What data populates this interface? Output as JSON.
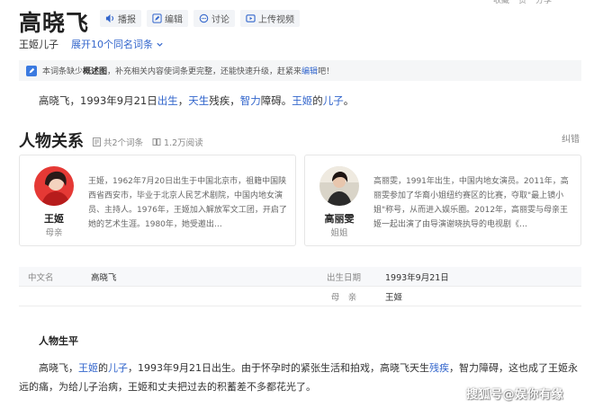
{
  "top_clip": [
    "收藏",
    "赞",
    "分享"
  ],
  "title": "高晓飞",
  "actions": [
    {
      "label": "播报",
      "icon": "speaker-icon"
    },
    {
      "label": "编辑",
      "icon": "pencil-icon"
    },
    {
      "label": "讨论",
      "icon": "chat-icon"
    },
    {
      "label": "上传视频",
      "icon": "video-icon"
    }
  ],
  "subtitle": {
    "son": "王姬儿子",
    "expand": "展开10个同名词条"
  },
  "notice": {
    "pre": "本词条缺少",
    "bold": "概述图",
    "mid": "，补充相关内容使词条更完整，还能快速升级，赶紧来",
    "link": "编辑",
    "post": "吧！"
  },
  "intro": {
    "p1": "高晓飞，1993年9月21日",
    "l1": "出生",
    "p2": "，",
    "l2": "天生",
    "p3": "残疾，",
    "l3": "智力",
    "p4": "障碍。",
    "l4": "王姬",
    "p5": "的",
    "l5": "儿子",
    "p6": "。"
  },
  "relations": {
    "title": "人物关系",
    "entries": "共2个词条",
    "views": "1.2万阅读",
    "error": "纠错",
    "cards": [
      {
        "name": "王姬",
        "relation": "母亲",
        "desc": "王姬，1962年7月20日出生于中国北京市，祖籍中国陕西省西安市，毕业于北京人民艺术剧院，中国内地女演员、主持人。1976年，王姬加入解放军文工团，开启了她的艺术生涯。1980年，她受邀出…"
      },
      {
        "name": "高丽雯",
        "relation": "姐姐",
        "desc": "高丽雯，1991年出生，中国内地女演员。2011年，高丽雯参加了华裔小姐纽约赛区的比赛，夺取\"最上镜小姐\"称号，从而进入娱乐圈。2012年，高丽雯与母亲王姬一起出演了由导演谢晓执导的电视剧《…"
      }
    ]
  },
  "basic_info": [
    {
      "k1": "中文名",
      "v1": "高晓飞",
      "k2": "出生日期",
      "v2": "1993年9月21日"
    },
    {
      "k1": "",
      "v1": "",
      "k2": "母　亲",
      "v2": "王姬"
    }
  ],
  "life": {
    "heading": "人物生平",
    "p1": "高晓飞，",
    "l1": "王姬",
    "p2": "的",
    "l2": "儿子",
    "p3": "，1993年9月21日出生。由于怀孕时的紧张生活和拍戏，高晓飞天生",
    "l3": "残疾",
    "p4": "，智力障碍，这也成了王姬永远的痛，为给儿子治病，王姬和丈夫把过去的积蓄差不多都花光了。"
  },
  "watermark": "搜狐号@娱你有缘",
  "colors": {
    "link": "#3366cc",
    "notice_icon": "#3b7ae0"
  }
}
